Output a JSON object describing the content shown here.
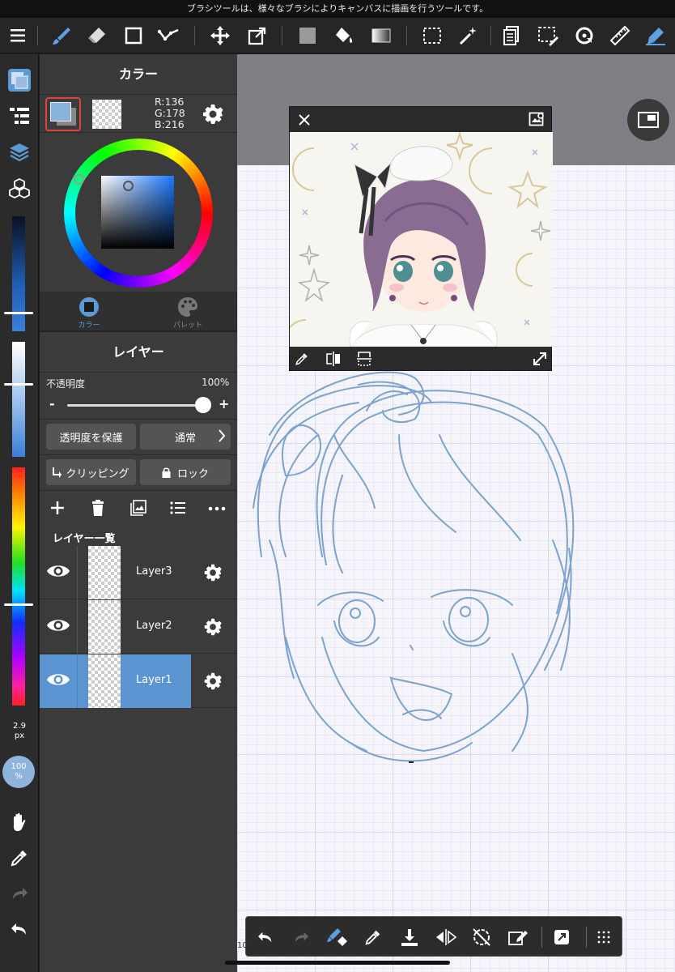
{
  "status_bar": {
    "message": "ブラシツールは、様々なブラシによりキャンバスに描画を行うツールです。"
  },
  "toolbar": {
    "icons": [
      "menu-icon",
      "brush-tool-icon",
      "eraser-tool-icon",
      "shape-tool-icon",
      "line-tool-icon",
      "move-tool-icon",
      "transform-tool-icon",
      "fill-color-icon",
      "bucket-tool-icon",
      "gradient-tool-icon",
      "select-tool-icon",
      "magic-wand-icon",
      "copy-icon",
      "select-pen-icon",
      "rotate-icon",
      "ruler-icon",
      "pen-settings-icon"
    ]
  },
  "left_sidebar": {
    "brush_size": "2.9",
    "brush_size_unit": "px",
    "opacity_value": "100",
    "opacity_unit": "%"
  },
  "color_panel": {
    "title": "カラー",
    "rgb": {
      "r": "R:136",
      "g": "G:178",
      "b": "B:216"
    },
    "foreground_color": "#88b2d8",
    "tabs": [
      {
        "label": "カラー",
        "active": true
      },
      {
        "label": "パレット",
        "active": false
      }
    ]
  },
  "layer_panel": {
    "title": "レイヤー",
    "opacity_label": "不透明度",
    "opacity_value": "100%",
    "minus": "-",
    "plus": "+",
    "protect_alpha": "透明度を保護",
    "blend_mode": "通常",
    "clipping": "クリッピング",
    "lock": "ロック",
    "list_title": "レイヤー一覧",
    "layers": [
      {
        "name": "Layer3",
        "selected": false
      },
      {
        "name": "Layer2",
        "selected": false
      },
      {
        "name": "Layer1",
        "selected": true
      }
    ]
  },
  "bottom_bar": {
    "zoom_fragment": "10",
    "icons": [
      "undo-icon",
      "redo-icon",
      "brush-eraser-toggle-icon",
      "eyedropper-icon",
      "save-icon",
      "flip-icon",
      "rotate-reset-icon",
      "edit-icon",
      "export-icon",
      "more-icon"
    ]
  },
  "colors": {
    "accent": "#5b9bd5",
    "panel_bg": "#3b3b3b",
    "selected_layer": "#5b95d1",
    "sketch": "#7ea2cf"
  }
}
